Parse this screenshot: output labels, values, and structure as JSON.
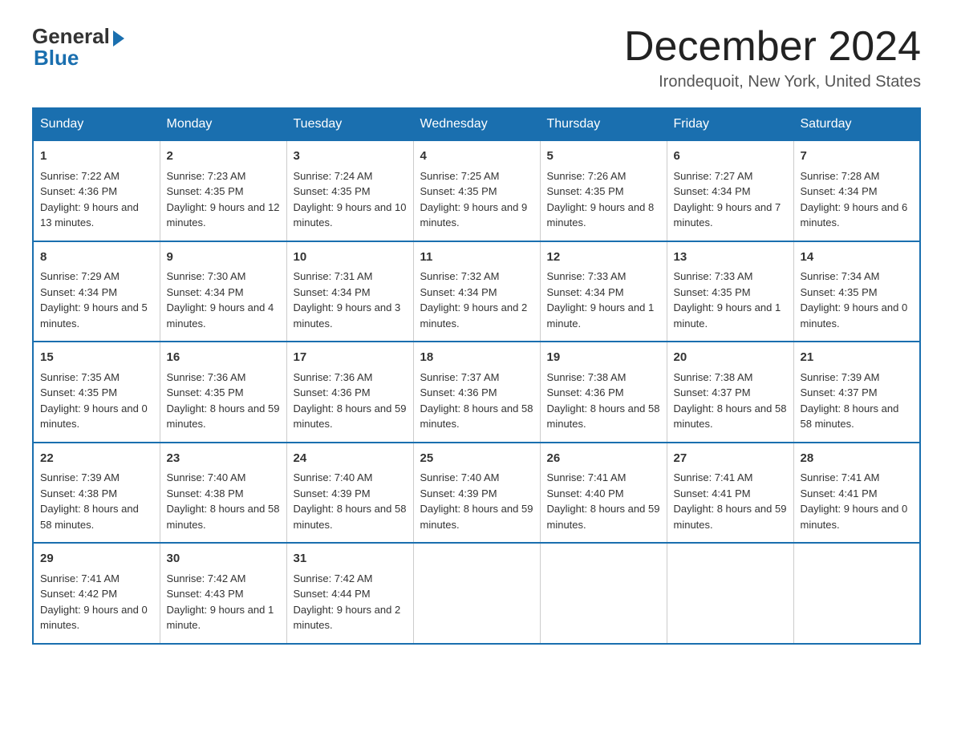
{
  "header": {
    "logo_general": "General",
    "logo_blue": "Blue",
    "month_title": "December 2024",
    "location": "Irondequoit, New York, United States"
  },
  "days_of_week": [
    "Sunday",
    "Monday",
    "Tuesday",
    "Wednesday",
    "Thursday",
    "Friday",
    "Saturday"
  ],
  "weeks": [
    [
      {
        "day": "1",
        "sunrise": "7:22 AM",
        "sunset": "4:36 PM",
        "daylight": "9 hours and 13 minutes."
      },
      {
        "day": "2",
        "sunrise": "7:23 AM",
        "sunset": "4:35 PM",
        "daylight": "9 hours and 12 minutes."
      },
      {
        "day": "3",
        "sunrise": "7:24 AM",
        "sunset": "4:35 PM",
        "daylight": "9 hours and 10 minutes."
      },
      {
        "day": "4",
        "sunrise": "7:25 AM",
        "sunset": "4:35 PM",
        "daylight": "9 hours and 9 minutes."
      },
      {
        "day": "5",
        "sunrise": "7:26 AM",
        "sunset": "4:35 PM",
        "daylight": "9 hours and 8 minutes."
      },
      {
        "day": "6",
        "sunrise": "7:27 AM",
        "sunset": "4:34 PM",
        "daylight": "9 hours and 7 minutes."
      },
      {
        "day": "7",
        "sunrise": "7:28 AM",
        "sunset": "4:34 PM",
        "daylight": "9 hours and 6 minutes."
      }
    ],
    [
      {
        "day": "8",
        "sunrise": "7:29 AM",
        "sunset": "4:34 PM",
        "daylight": "9 hours and 5 minutes."
      },
      {
        "day": "9",
        "sunrise": "7:30 AM",
        "sunset": "4:34 PM",
        "daylight": "9 hours and 4 minutes."
      },
      {
        "day": "10",
        "sunrise": "7:31 AM",
        "sunset": "4:34 PM",
        "daylight": "9 hours and 3 minutes."
      },
      {
        "day": "11",
        "sunrise": "7:32 AM",
        "sunset": "4:34 PM",
        "daylight": "9 hours and 2 minutes."
      },
      {
        "day": "12",
        "sunrise": "7:33 AM",
        "sunset": "4:34 PM",
        "daylight": "9 hours and 1 minute."
      },
      {
        "day": "13",
        "sunrise": "7:33 AM",
        "sunset": "4:35 PM",
        "daylight": "9 hours and 1 minute."
      },
      {
        "day": "14",
        "sunrise": "7:34 AM",
        "sunset": "4:35 PM",
        "daylight": "9 hours and 0 minutes."
      }
    ],
    [
      {
        "day": "15",
        "sunrise": "7:35 AM",
        "sunset": "4:35 PM",
        "daylight": "9 hours and 0 minutes."
      },
      {
        "day": "16",
        "sunrise": "7:36 AM",
        "sunset": "4:35 PM",
        "daylight": "8 hours and 59 minutes."
      },
      {
        "day": "17",
        "sunrise": "7:36 AM",
        "sunset": "4:36 PM",
        "daylight": "8 hours and 59 minutes."
      },
      {
        "day": "18",
        "sunrise": "7:37 AM",
        "sunset": "4:36 PM",
        "daylight": "8 hours and 58 minutes."
      },
      {
        "day": "19",
        "sunrise": "7:38 AM",
        "sunset": "4:36 PM",
        "daylight": "8 hours and 58 minutes."
      },
      {
        "day": "20",
        "sunrise": "7:38 AM",
        "sunset": "4:37 PM",
        "daylight": "8 hours and 58 minutes."
      },
      {
        "day": "21",
        "sunrise": "7:39 AM",
        "sunset": "4:37 PM",
        "daylight": "8 hours and 58 minutes."
      }
    ],
    [
      {
        "day": "22",
        "sunrise": "7:39 AM",
        "sunset": "4:38 PM",
        "daylight": "8 hours and 58 minutes."
      },
      {
        "day": "23",
        "sunrise": "7:40 AM",
        "sunset": "4:38 PM",
        "daylight": "8 hours and 58 minutes."
      },
      {
        "day": "24",
        "sunrise": "7:40 AM",
        "sunset": "4:39 PM",
        "daylight": "8 hours and 58 minutes."
      },
      {
        "day": "25",
        "sunrise": "7:40 AM",
        "sunset": "4:39 PM",
        "daylight": "8 hours and 59 minutes."
      },
      {
        "day": "26",
        "sunrise": "7:41 AM",
        "sunset": "4:40 PM",
        "daylight": "8 hours and 59 minutes."
      },
      {
        "day": "27",
        "sunrise": "7:41 AM",
        "sunset": "4:41 PM",
        "daylight": "8 hours and 59 minutes."
      },
      {
        "day": "28",
        "sunrise": "7:41 AM",
        "sunset": "4:41 PM",
        "daylight": "9 hours and 0 minutes."
      }
    ],
    [
      {
        "day": "29",
        "sunrise": "7:41 AM",
        "sunset": "4:42 PM",
        "daylight": "9 hours and 0 minutes."
      },
      {
        "day": "30",
        "sunrise": "7:42 AM",
        "sunset": "4:43 PM",
        "daylight": "9 hours and 1 minute."
      },
      {
        "day": "31",
        "sunrise": "7:42 AM",
        "sunset": "4:44 PM",
        "daylight": "9 hours and 2 minutes."
      },
      null,
      null,
      null,
      null
    ]
  ],
  "labels": {
    "sunrise_prefix": "Sunrise: ",
    "sunset_prefix": "Sunset: ",
    "daylight_prefix": "Daylight: "
  }
}
